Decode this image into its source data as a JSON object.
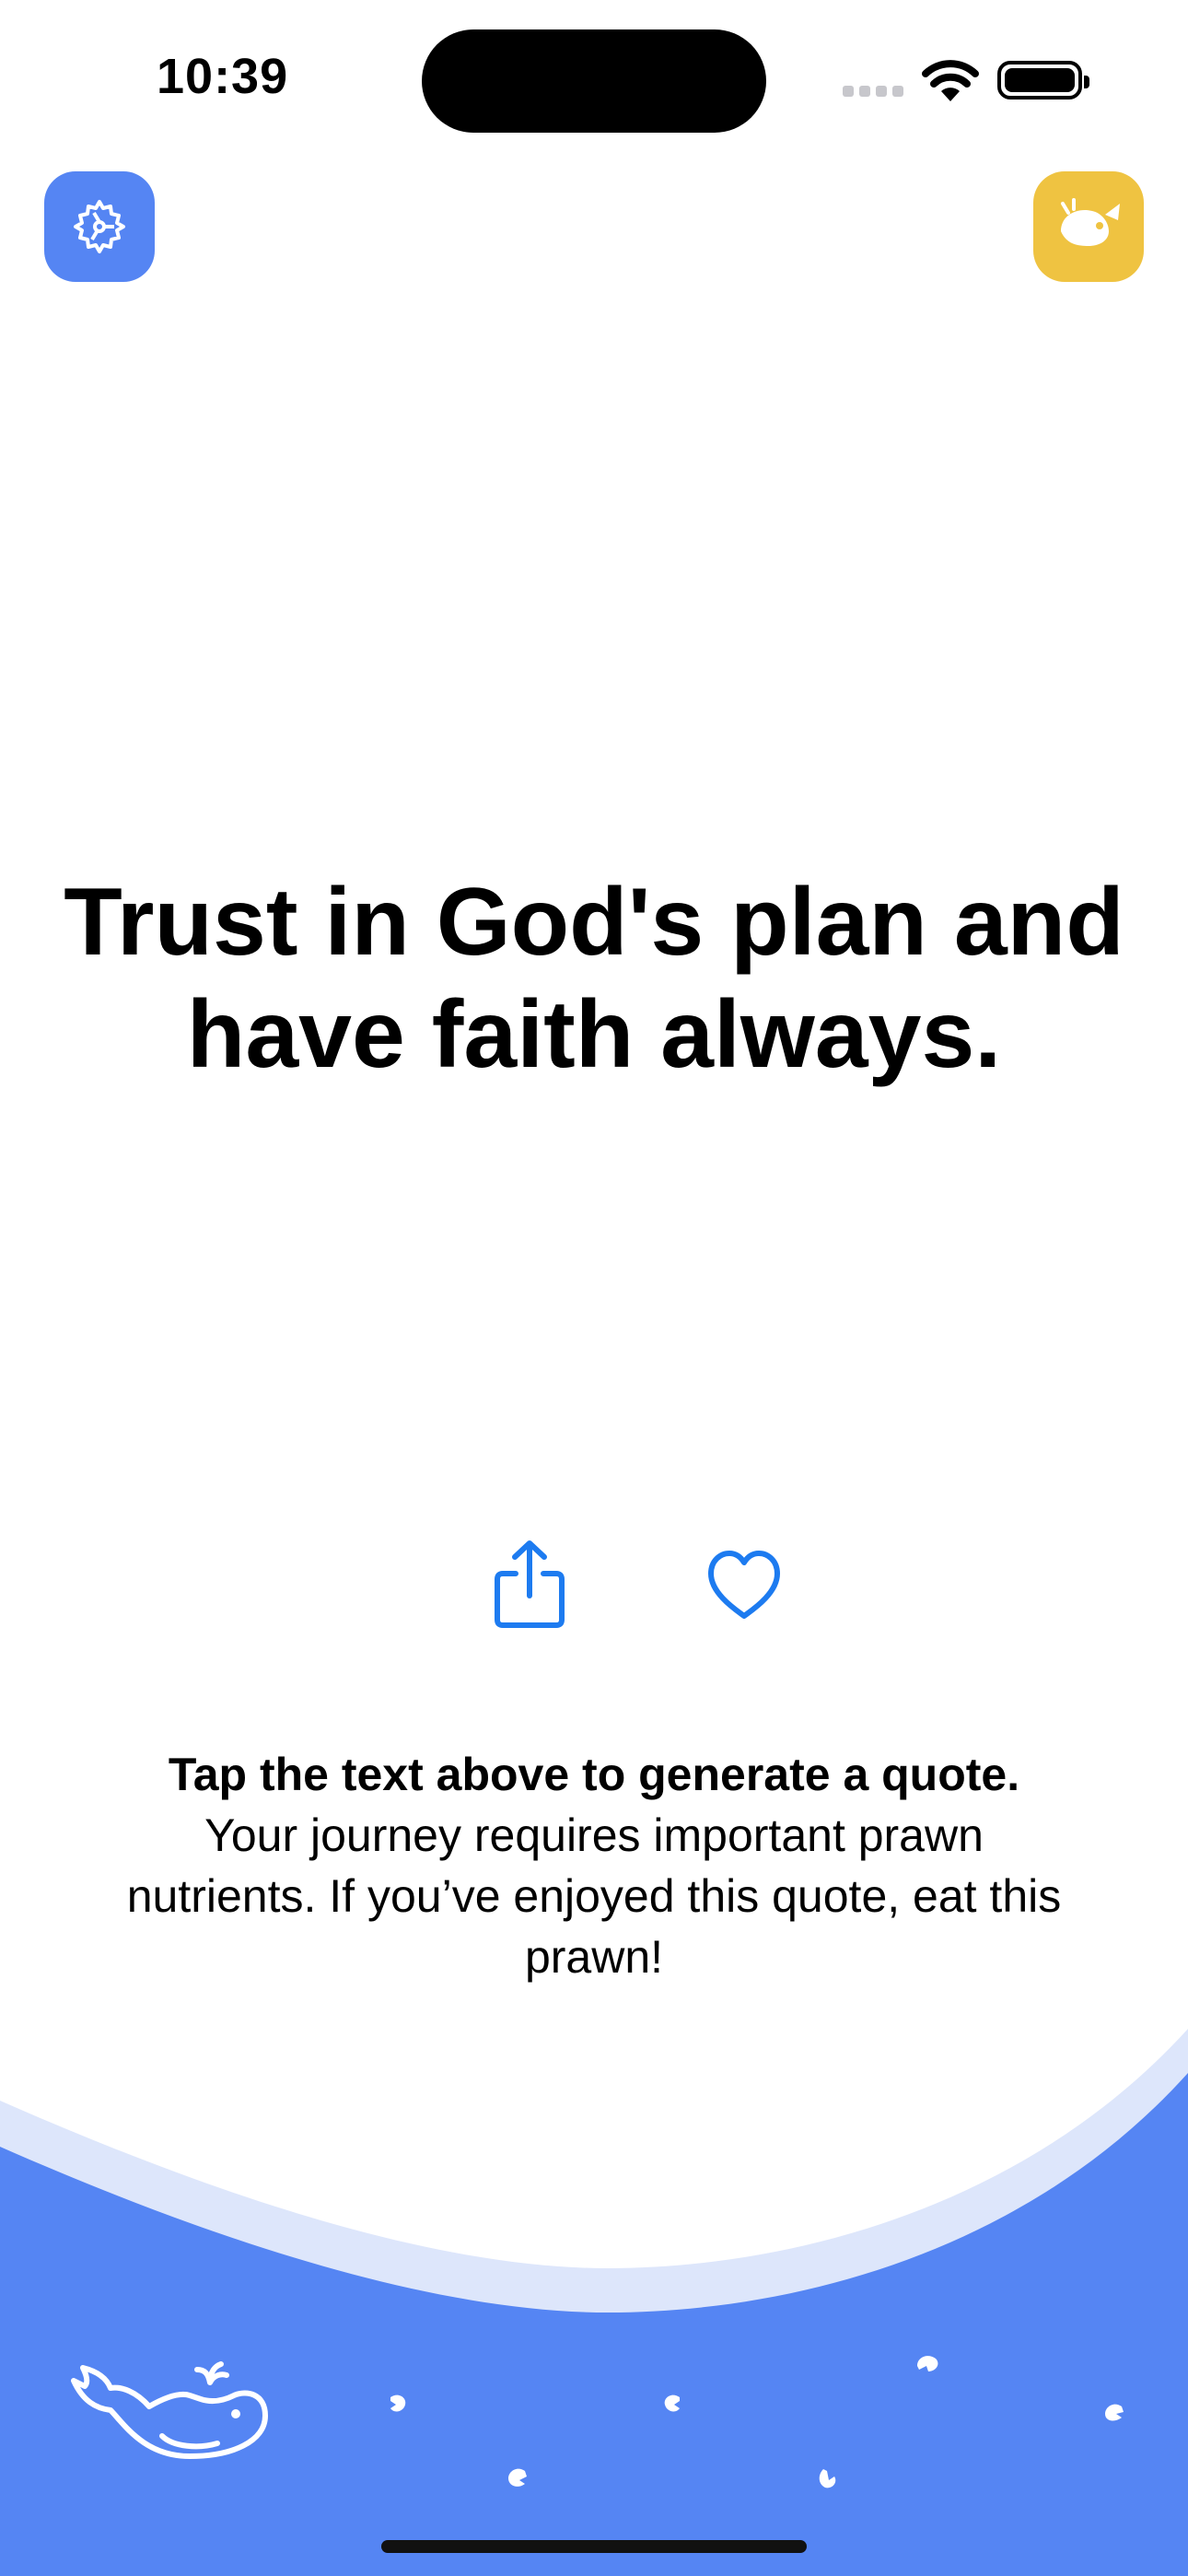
{
  "status_bar": {
    "time": "10:39"
  },
  "toolbar": {
    "settings_icon": "settings-gear-icon",
    "whale_icon": "whale-shop-icon"
  },
  "quote": {
    "text": "Trust in God's plan and have faith always."
  },
  "actions": {
    "share_icon": "share-icon",
    "favorite_icon": "heart-icon"
  },
  "info": {
    "headline": "Tap the text above to generate a quote.",
    "body": "Your journey requires important prawn nutrients. If you’ve enjoyed this quote, eat this prawn!"
  },
  "colors": {
    "blue": "#5585f3",
    "light_blue": "#dde6fb",
    "yellow": "#efc341",
    "icon_blue": "#1d7bf0"
  }
}
